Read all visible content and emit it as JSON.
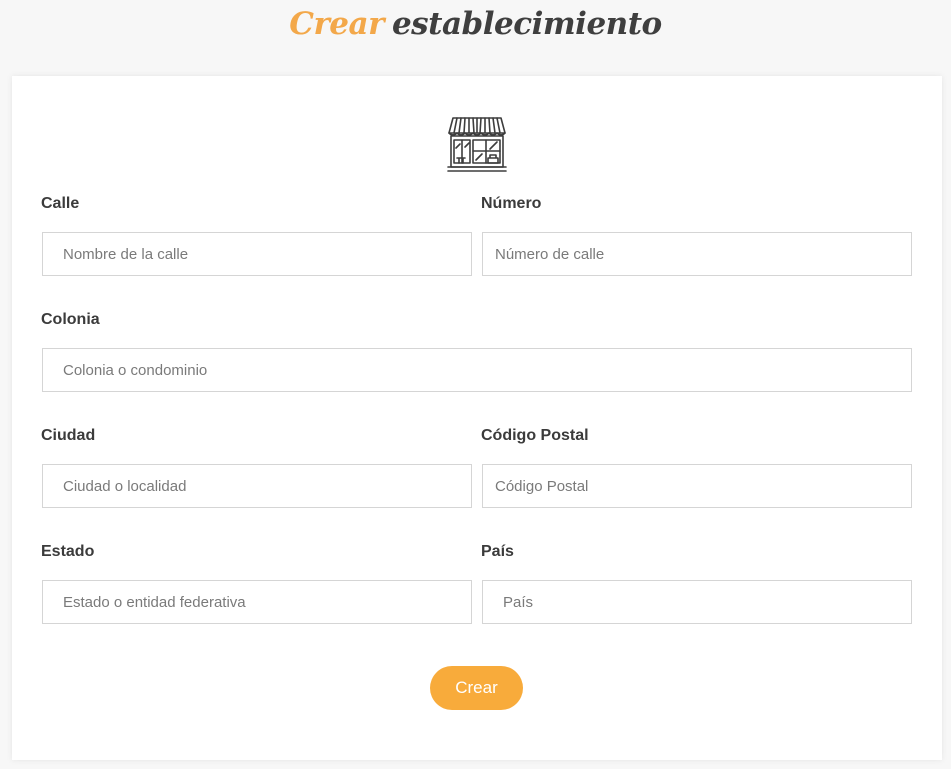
{
  "title": {
    "accent": "Crear",
    "main": "establecimiento"
  },
  "icons": {
    "store": "store-icon"
  },
  "form": {
    "calle": {
      "label": "Calle",
      "placeholder": "Nombre de la calle",
      "value": ""
    },
    "numero": {
      "label": "Número",
      "placeholder": "Número de calle",
      "value": ""
    },
    "colonia": {
      "label": "Colonia",
      "placeholder": "Colonia o condominio",
      "value": ""
    },
    "ciudad": {
      "label": "Ciudad",
      "placeholder": "Ciudad o localidad",
      "value": ""
    },
    "codigo_postal": {
      "label": "Código Postal",
      "placeholder": "Código Postal",
      "value": ""
    },
    "estado": {
      "label": "Estado",
      "placeholder": "Estado o entidad federativa",
      "value": ""
    },
    "pais": {
      "label": "País",
      "placeholder": "País",
      "value": ""
    },
    "submit_label": "Crear"
  },
  "colors": {
    "accent": "#f8ab3b",
    "title_accent": "#f3a84a",
    "text": "#3b3b3b",
    "border": "#d5d5d5",
    "background": "#f7f7f7",
    "card": "#ffffff"
  }
}
